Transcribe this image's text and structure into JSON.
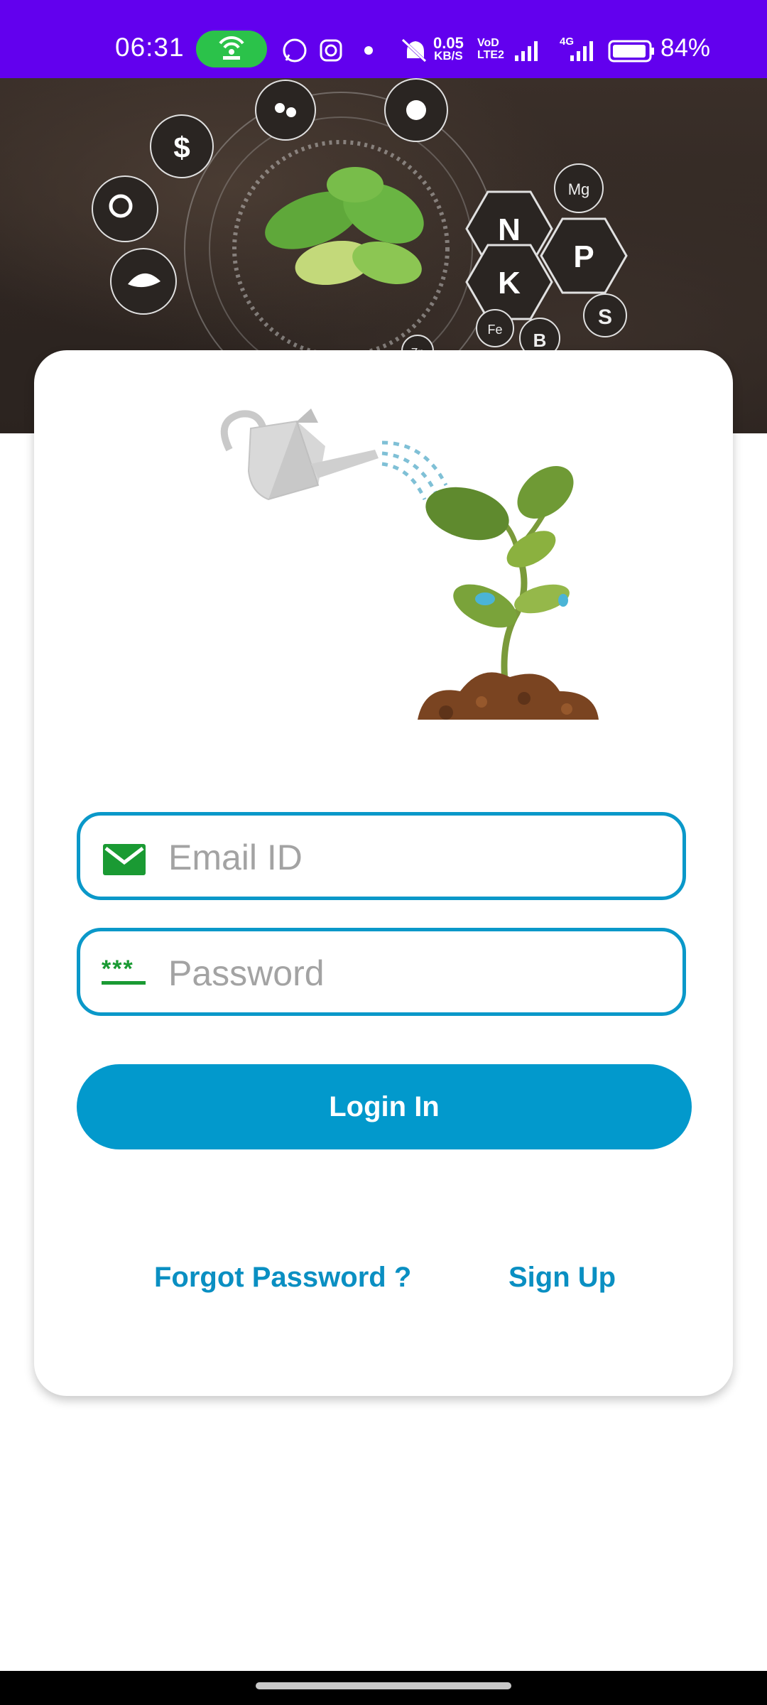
{
  "status_bar": {
    "time": "06:31",
    "net_speed_value": "0.05",
    "net_speed_unit": "KB/S",
    "volte_top": "VoD",
    "volte_bottom": "LTE2",
    "network_type": "4G",
    "battery_percent": "84%",
    "icons": [
      "hotspot-icon",
      "whatsapp-icon",
      "instagram-icon",
      "dot-icon",
      "mute-icon",
      "signal-icon",
      "signal-icon",
      "battery-icon"
    ]
  },
  "header": {
    "nutrients": [
      "N",
      "P",
      "K",
      "Mg",
      "S",
      "Fe",
      "B",
      "Zn"
    ],
    "symbols": [
      "$"
    ]
  },
  "login": {
    "email_placeholder": "Email ID",
    "password_placeholder": "Password",
    "password_icon_text": "***",
    "login_button": "Login In",
    "forgot_password": "Forgot Password ?",
    "sign_up": "Sign Up"
  },
  "colors": {
    "status_bar": "#6200ee",
    "accent": "#0299cc",
    "field_border": "#0a98c9",
    "icon_green": "#1a9a33",
    "link": "#0a8fc2"
  }
}
